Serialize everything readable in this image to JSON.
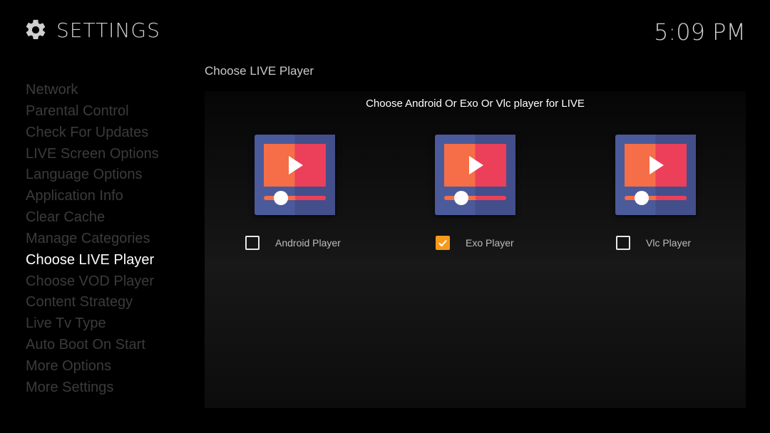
{
  "header": {
    "title": "SETTINGS",
    "clock": "5:09 PM"
  },
  "sidebar": {
    "active_index": 8,
    "items": [
      {
        "label": "Network"
      },
      {
        "label": "Parental Control"
      },
      {
        "label": "Check For Updates"
      },
      {
        "label": "LIVE Screen Options"
      },
      {
        "label": "Language Options"
      },
      {
        "label": "Application Info"
      },
      {
        "label": "Clear Cache"
      },
      {
        "label": "Manage Categories"
      },
      {
        "label": "Choose LIVE Player"
      },
      {
        "label": "Choose VOD Player"
      },
      {
        "label": "Content Strategy"
      },
      {
        "label": "Live Tv Type"
      },
      {
        "label": "Auto Boot On Start"
      },
      {
        "label": "More Options"
      },
      {
        "label": "More Settings"
      }
    ]
  },
  "main": {
    "section_title": "Choose LIVE Player",
    "subtitle": "Choose Android Or Exo Or Vlc player for LIVE",
    "players": [
      {
        "label": "Android Player",
        "checked": false,
        "icon": "video-player-icon"
      },
      {
        "label": "Exo Player",
        "checked": true,
        "icon": "video-player-icon"
      },
      {
        "label": "Vlc Player",
        "checked": false,
        "icon": "video-player-icon"
      }
    ]
  },
  "colors": {
    "accent": "#f59a1b",
    "inactive_menu": "#3b3b3b",
    "active_menu": "#ffffff",
    "icon_frame": "#4b5a9a",
    "icon_screen_left": "#f56e47",
    "icon_screen_right": "#ec3f5a"
  }
}
